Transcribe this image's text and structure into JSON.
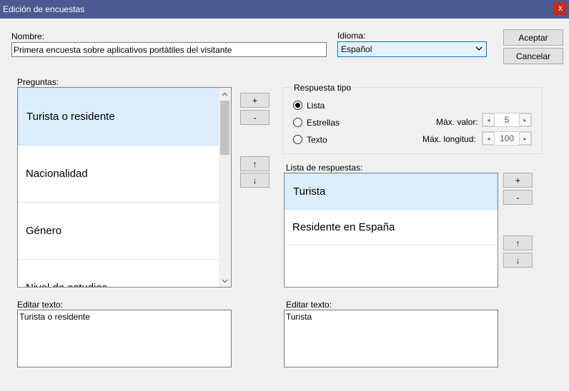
{
  "window": {
    "title": "Edición de encuestas",
    "close_label": "x"
  },
  "form": {
    "name_label": "Nombre:",
    "name_value": "Primera encuesta sobre aplicativos portátiles del visitante",
    "language_label": "Idioma:",
    "language_value": "Español",
    "accept_label": "Aceptar",
    "cancel_label": "Cancelar"
  },
  "questions": {
    "label": "Preguntas:",
    "items": [
      "Turista o residente",
      "Nacionalidad",
      "Género",
      "Nivel de estudios"
    ],
    "selected_index": 0,
    "add_label": "+",
    "remove_label": "-",
    "up_label": "↑",
    "down_label": "↓",
    "edit_label": "Editar texto:",
    "edit_value": "Turista o residente"
  },
  "answer_type": {
    "title": "Respuesta tipo",
    "options": [
      "Lista",
      "Estrellas",
      "Texto"
    ],
    "selected": "Lista",
    "max_value_label": "Máx. valor:",
    "max_value": "5",
    "max_length_label": "Máx. longitud:",
    "max_length": "100"
  },
  "answers": {
    "label": "Lista de respuestas:",
    "items": [
      "Turista",
      "Residente en España"
    ],
    "selected_index": 0,
    "add_label": "+",
    "remove_label": "-",
    "up_label": "↑",
    "down_label": "↓",
    "edit_label": "Editar texto:",
    "edit_value": "Turista"
  }
}
